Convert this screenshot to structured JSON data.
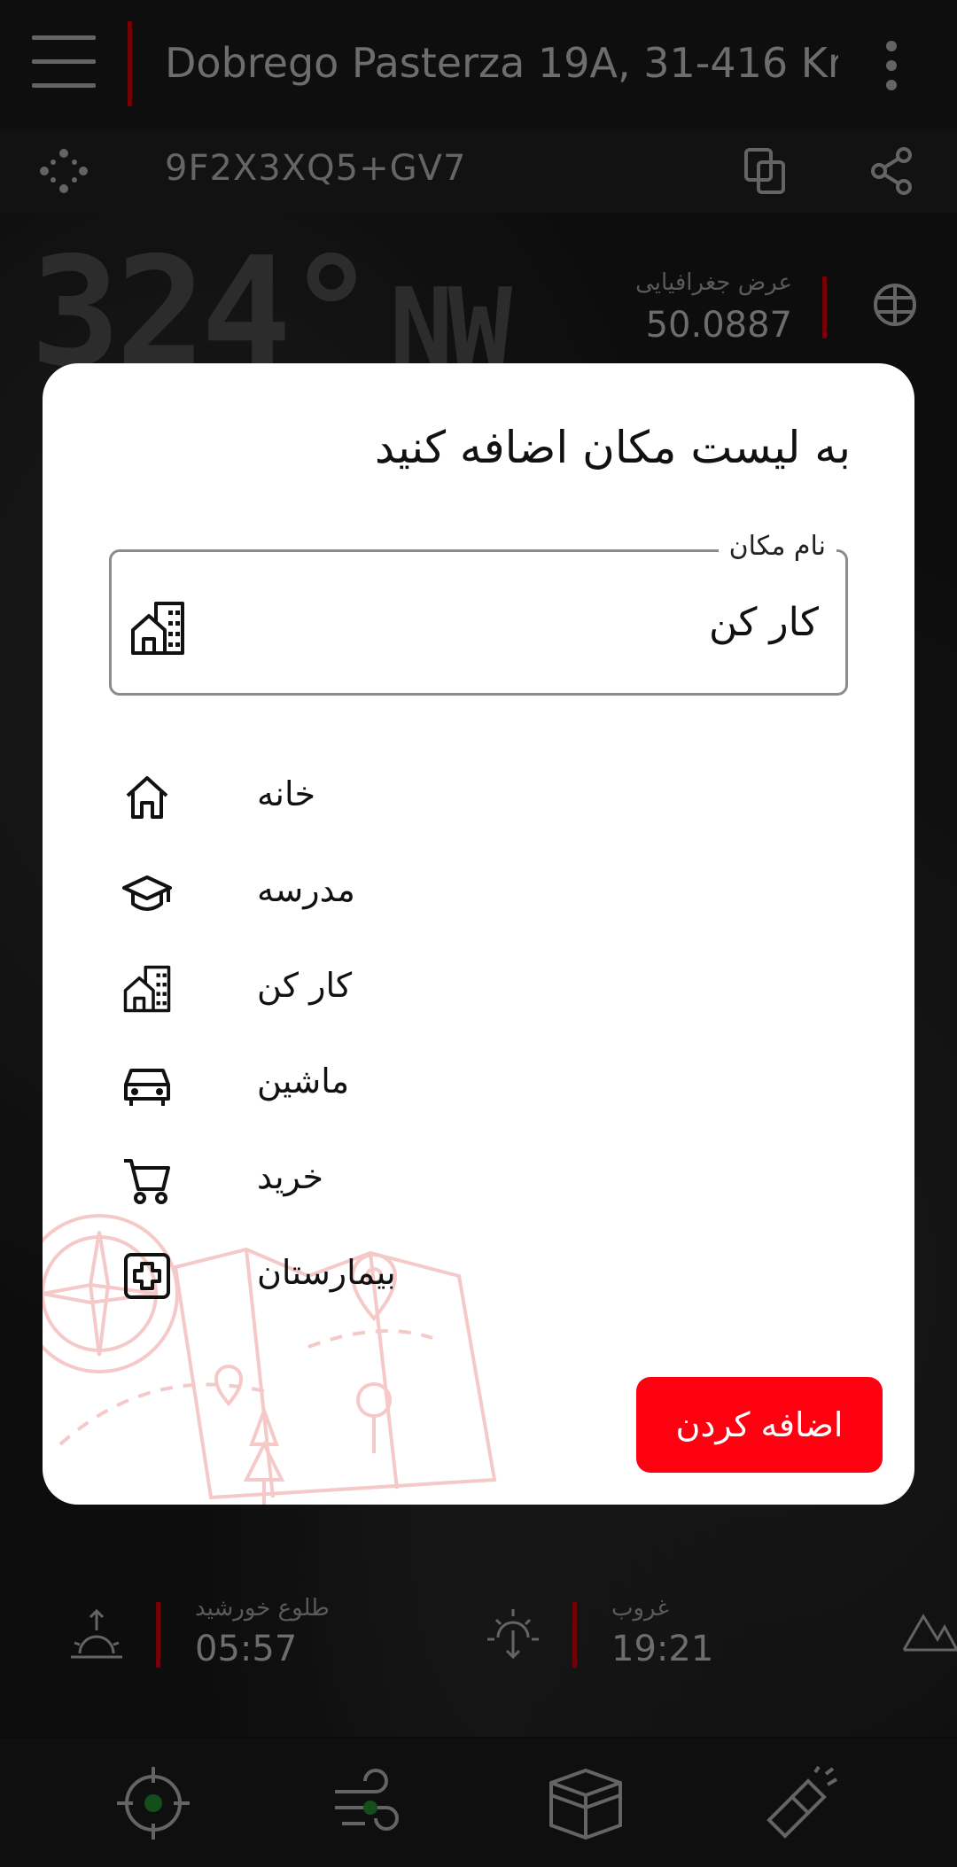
{
  "appbar": {
    "address": "Dobrego Pasterza 19A, 31-416 Kr..",
    "plus_code": "9F2X3XQ5+GV7"
  },
  "compass": {
    "heading_value": "324°",
    "heading_dir": "NW",
    "latitude_label": "عرض جغرافیایی",
    "latitude_value": "50.0887"
  },
  "dialog": {
    "title": "به لیست مکان اضافه کنید",
    "field_label": "نام مکان",
    "field_value": "کار کن",
    "field_icon": "building-icon",
    "options": [
      {
        "label": "خانه",
        "icon": "home-icon"
      },
      {
        "label": "مدرسه",
        "icon": "graduation-cap-icon"
      },
      {
        "label": "کار کن",
        "icon": "building-icon"
      },
      {
        "label": "ماشین",
        "icon": "car-icon"
      },
      {
        "label": "خرید",
        "icon": "cart-icon"
      },
      {
        "label": "بیمارستان",
        "icon": "hospital-icon"
      }
    ],
    "add_button": "اضافه کردن"
  },
  "sun": {
    "sunrise_label": "طلوع خورشید",
    "sunrise_time": "05:57",
    "sunset_label": "غروب",
    "sunset_time": "19:21"
  },
  "bottom_nav": [
    {
      "icon": "crosshair-icon"
    },
    {
      "icon": "wind-icon"
    },
    {
      "icon": "kaaba-icon"
    },
    {
      "icon": "flashlight-icon"
    }
  ],
  "colors": {
    "accent": "#ff0010",
    "divider": "#b3000c",
    "background": "#111111",
    "nav_dot": "#1f7a2a"
  }
}
